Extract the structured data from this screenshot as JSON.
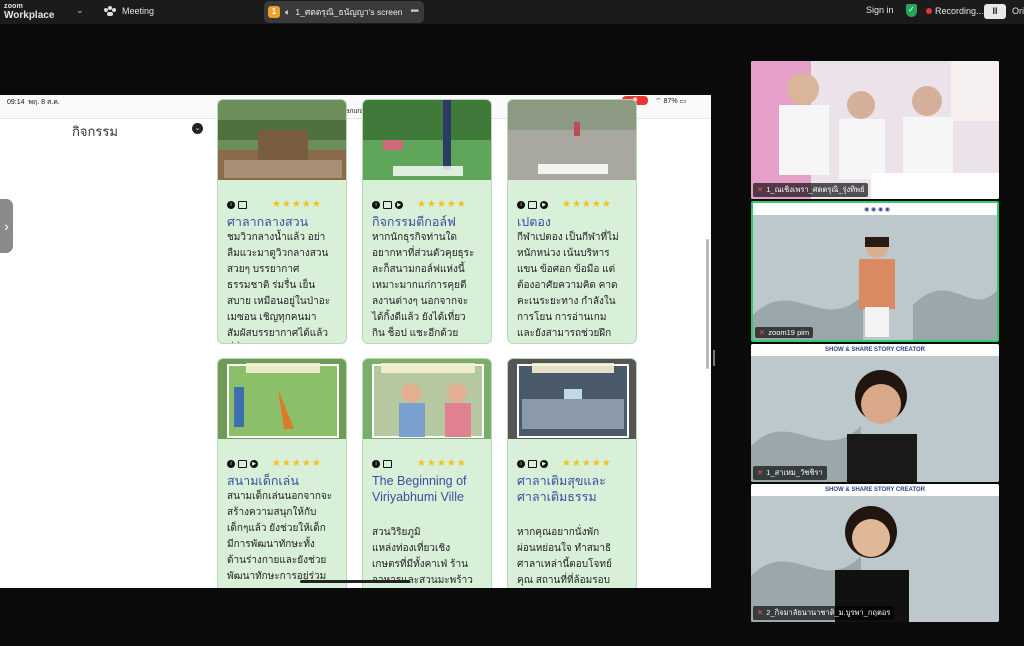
{
  "app": {
    "logo_line1": "zoom",
    "logo_line2": "Workplace",
    "meeting_label": "Meeting",
    "share_badge": "1",
    "share_title": "1_ศตตรุณิ_ธนัญญา's screen",
    "sign_in": "Sign in",
    "recording": "Recording...",
    "pause_label": "II",
    "user_cut": "Ori"
  },
  "phone": {
    "time": "09:14",
    "date": "พฤ. 8 ส.ค.",
    "battery": "87%",
    "url": "navanurak.in.th",
    "section_title": "กิจกรรม"
  },
  "cards": [
    {
      "title": "ศาลากลางสวน",
      "desc": "ชมวิวกลางน้ำแล้ว อย่า\nลืมแวะมาดูวิวกลางสวน\nสวยๆ บรรยากาศ\nธรรมชาติ ร่มรื่น เย็น\nสบาย เหมือนอยู่ในป่าอะ\nเมซอน เชิญทุกคนมา\nสัมผัสบรรยากาศได้แล้ว\nที่นี่"
    },
    {
      "title": "กิจกรรมตีกอล์ฟ",
      "desc": "หากนักธุรกิจท่านใด\nอยากหาที่ส่วนตัวคุยธุระ\nละก็สนามกอล์ฟแห่งนี้\nเหมาะมากแก่การคุยตี\nลงานต่างๆ นอกจากจะ\nได้กิ้งดีแล้ว ยังได้เที่ยว\nกิน ช็อป แชะอีกด้วย"
    },
    {
      "title": "เปตอง",
      "desc": "กีฬาเปตอง เป็นกีฬาที่ไม่\nหนักหน่วง เน้นบริหาร\nแขน ข้อศอก ข้อมือ แต่\nต้องอาศัยความคิด คาด\nคะเนระยะทาง กำลังใน\nการโยน การอ่านเกม\nและยังสามารถช่วยฝึก\nสมาธิได้อีกด้วย"
    },
    {
      "title": "สนามเด็กเล่น",
      "desc": "สนามเด็กเล่นนอกจากจะ\nสร้างความสนุกให้กับ\nเด็กๆแล้ว ยังช่วยให้เด็ก\nมีการพัฒนาทักษะทั้ง\nด้านร่างกายและยังช่วย\nพัฒนาทักษะการอยู่ร่วม"
    },
    {
      "title": "The Beginning of Viriyabhumi Ville",
      "desc": "    สวนวิริยภูมิ\nแหล่งท่องเที่ยวเชิง\nเกษตรที่มีทั้งคาเฟ่ ร้าน\nอาหารและสวนมะพร้าว"
    },
    {
      "title": "ศาลาเติมสุขและศาลาเติมธรรม",
      "desc": "หากคุณอยากนั่งพัก\nผ่อนหย่อนใจ ทำสมาธิ\nศาลาเหล่านี้ตอบโจทย์\nคุณ สถานที่ที่ล้อมรอบ\nไปดอกไม้ พืชพรรณ ที่"
    }
  ],
  "participants": [
    {
      "name": "1_ณเชิงเพรา_ศตตรุณิ_รุ่งทิพย์"
    },
    {
      "name": "zoom19 pim"
    },
    {
      "name": "1_สาเหม_วัชชิรา"
    },
    {
      "name": "2_กิจมาลัยนานาชาติ_ม.บูรพา_กฤตอร"
    }
  ],
  "banner": {
    "text": "SHOW & SHARE STORY CREATOR"
  },
  "colors": {
    "accent_green": "#2ecc71",
    "star": "#f2c31a",
    "card_bg": "#d8efd8",
    "title_blue": "#3a4ea0"
  }
}
